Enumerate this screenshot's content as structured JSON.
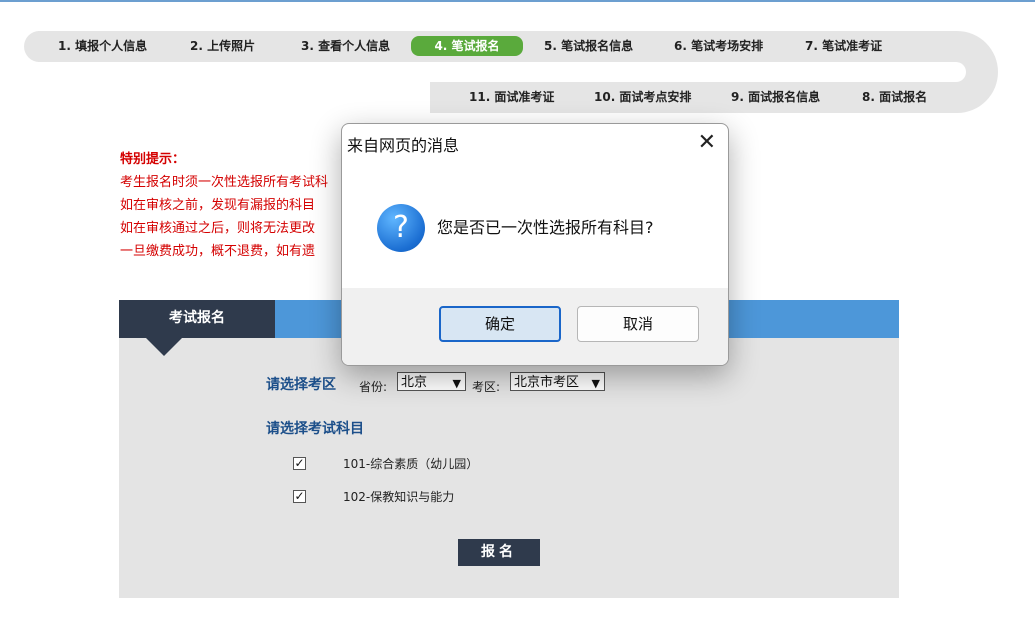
{
  "steps_row1": [
    {
      "label": "1. 填报个人信息"
    },
    {
      "label": "2. 上传照片"
    },
    {
      "label": "3. 查看个人信息"
    },
    {
      "label": "4. 笔试报名"
    },
    {
      "label": "5. 笔试报名信息"
    },
    {
      "label": "6. 笔试考场安排"
    },
    {
      "label": "7. 笔试准考证"
    }
  ],
  "steps_row2": [
    {
      "label": "11. 面试准考证"
    },
    {
      "label": "10. 面试考点安排"
    },
    {
      "label": "9. 面试报名信息"
    },
    {
      "label": "8. 面试报名"
    }
  ],
  "active_step": "4. 笔试报名",
  "notice": {
    "title": "特别提示：",
    "lines": [
      "考生报名时须一次性选报所有考试科",
      "如在审核之前，发现有漏报的科目",
      "如在审核通过之后，则将无法更改",
      "一旦缴费成功，概不退费，如有遗"
    ]
  },
  "panel": {
    "tab_label": "考试报名",
    "region_label": "请选择考区",
    "province_label": "省份:",
    "province_value": "北京",
    "district_label": "考区:",
    "district_value": "北京市考区",
    "subjects_label": "请选择考试科目",
    "subjects": [
      {
        "label": "101-综合素质（幼儿园）",
        "checked": "✓"
      },
      {
        "label": "102-保教知识与能力",
        "checked": "✓"
      }
    ],
    "submit_label": "报名"
  },
  "dialog": {
    "title": "来自网页的消息",
    "close_glyph": "✕",
    "icon_glyph": "?",
    "message": "您是否已一次性选报所有科目?",
    "ok_label": "确定",
    "cancel_label": "取消"
  },
  "colors": {
    "active_step": "#5aaa3c",
    "notice_text": "#d40000",
    "panel_bg": "#e4e4e4",
    "panel_header_blue": "#4d97d9",
    "tab_dark": "#2f3a4c",
    "section_label": "#1c4f8a",
    "dialog_ok_border": "#1a66c9"
  }
}
